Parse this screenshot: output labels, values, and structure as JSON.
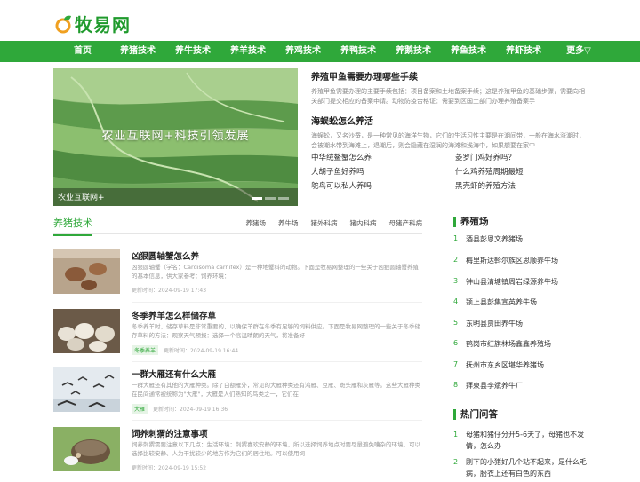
{
  "site": {
    "name": "牧易网",
    "accent": "#2fa83a"
  },
  "nav": [
    "首页",
    "养猪技术",
    "养牛技术",
    "养羊技术",
    "养鸡技术",
    "养鸭技术",
    "养鹅技术",
    "养鱼技术",
    "养虾技术",
    "更多▽"
  ],
  "hero": {
    "caption": "农业互联网+科技引领发展",
    "label": "农业互联网+"
  },
  "top_news": [
    {
      "title": "养殖甲鱼需要办理哪些手续",
      "desc": "养殖甲鱼需要办理的主要手续包括：项目备案和土地备案手续；这是养殖甲鱼的基础步骤，需要向相关部门提交相应的备案申请。动物防疫合格证：需要到区国土部门办理养殖备案手"
    },
    {
      "title": "海蜈蚣怎么养活",
      "desc": "海蜈蚣，又名沙蚕，是一种常见的海洋生物，它们的生活习性主要是在潮间带，一般在海水涨潮时，会被潮水带到海滩上，退潮后，则会隐藏在湿润的海滩和浅海中，如果想要在家中"
    }
  ],
  "link_grid": [
    "中华绒鳌蟹怎么养",
    "菱罗门鸡好养吗？",
    "大胡子鱼好养吗",
    "什么鸡养殖周期最短",
    "鸵鸟可以私人养吗",
    "黑壳虾的养殖方法"
  ],
  "section": {
    "title": "养猪技术",
    "tabs": [
      "养猪场",
      "养牛场",
      "猪外科病",
      "猪内科病",
      "母猪产科病"
    ]
  },
  "articles": [
    {
      "title": "凶狠圆轴蟹怎么养",
      "desc": "凶狠圆轴蟹（学名：Cardisoma carnifex）是一种地蟹科的动物。下面是牧易网整理的一些关于凶狠圆轴蟹养殖的基本信息，供大家参考：饲养环境：",
      "tag": "",
      "meta": "更新时间：2024-09-19 17:43"
    },
    {
      "title": "冬季养羊怎么样储存草",
      "desc": "冬季养羊时，储存草料是非常重要的，以确保羊群在冬季有足够的饲料供应。下面是牧易网整理的一些关于冬季储存草料的方法：观察天气预报：选择一个高温晴朗的天气，将准备好",
      "tag": "冬季养羊",
      "meta": "更新时间：2024-09-19 16:44"
    },
    {
      "title": "一群大雁还有什么大雁",
      "desc": "一群大雁还有其他的大雁种类。除了白额雁外，常见的大雁种类还有鸿雁、豆雁、斑头雁和灰雁等。这些大雁种类在民间通常被统称为\"大雁\"，大雁是人们熟知的鸟类之一，它们在",
      "tag": "大雁",
      "meta": "更新时间：2024-09-19 16:36"
    },
    {
      "title": "饲养刺猬的注意事项",
      "desc": "饲养刺猬需要注意以下几点：生活环境：刺猬喜欢安静的环境，所以选择饲养地点时要尽量避免嘈杂的环境，可以选择比较安静、人为干扰较少的地方作为它们的居住地。可以使用饲",
      "tag": "",
      "meta": "更新时间：2024-09-19 15:52"
    }
  ],
  "farms": {
    "title": "养殖场",
    "items": [
      "酒县彭恩文养猪场",
      "梅里斯达斡尔族区思顺养牛场",
      "钟山县清塘镇周岩绿源养牛场",
      "颍上县彭集宣英养牛场",
      "东明县贾田养牛场",
      "鹤岗市红旗林场鑫鑫养殖场",
      "抚州市东乡区堪华养猪场",
      "拜泉县李斌养牛厂"
    ]
  },
  "hot": {
    "title": "热门问答",
    "items": [
      "母猪和猪仔分开5-6天了，母猪也不发情，怎么办",
      "刚下的小猪好几个站不起来，是什么毛病，胎衣上还有白色的东西"
    ]
  }
}
